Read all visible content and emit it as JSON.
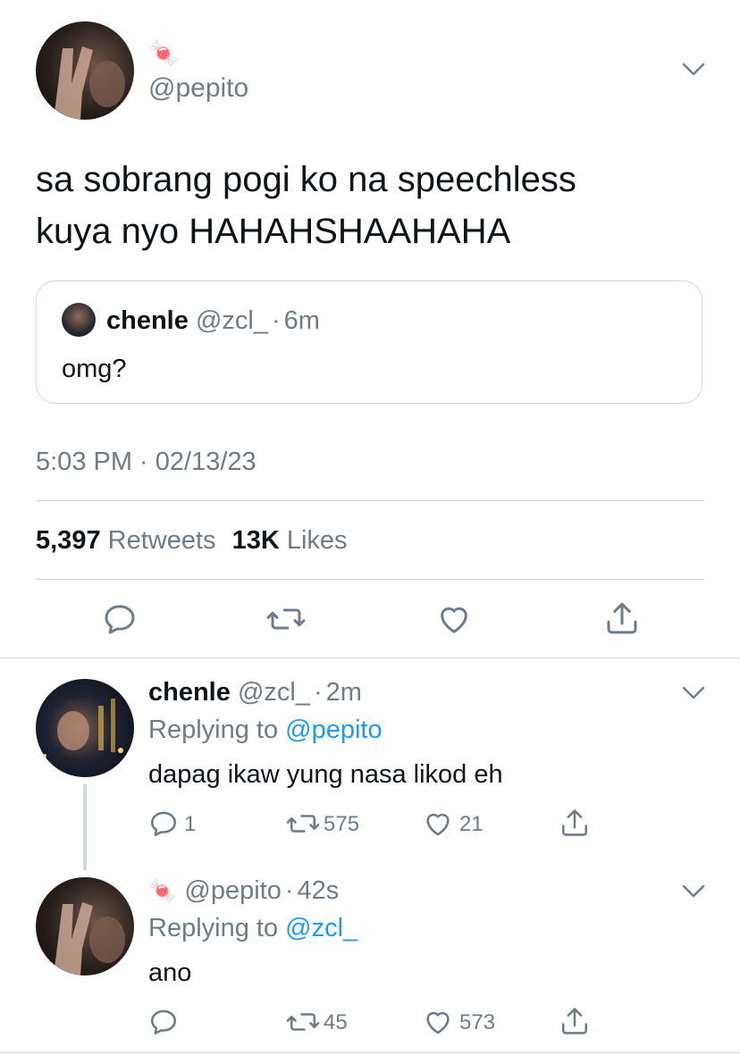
{
  "main_tweet": {
    "display_name_emoji": "🍬",
    "handle": "@pepito",
    "text_line1": "sa sobrang pogi ko na speechless",
    "text_line2": "kuya nyo HAHAHSHAAHAHA",
    "quoted": {
      "name": "chenle",
      "handle": "@zcl_",
      "sep": "·",
      "time": "6m",
      "text": "omg?"
    },
    "timestamp": "5:03 PM · 02/13/23",
    "retweets_count": "5,397",
    "retweets_label": "Retweets",
    "likes_count": "13K",
    "likes_label": "Likes"
  },
  "replies": [
    {
      "name": "chenle",
      "handle": "@zcl_",
      "sep": "·",
      "time": "2m",
      "replying_prefix": "Replying to ",
      "replying_to": "@pepito",
      "text": "dapag ikaw yung nasa likod eh",
      "reply_count": "1",
      "retweet_count": "575",
      "like_count": "21"
    },
    {
      "name_emoji": "🍬",
      "handle": "@pepito",
      "sep": "·",
      "time": "42s",
      "replying_prefix": "Replying to ",
      "replying_to": "@zcl_",
      "text": "ano",
      "reply_count": "",
      "retweet_count": "45",
      "like_count": "573"
    }
  ],
  "colors": {
    "text": "#0f1419",
    "muted": "#6e7c87",
    "link": "#1d9bf0",
    "divider": "#cfd9de"
  }
}
